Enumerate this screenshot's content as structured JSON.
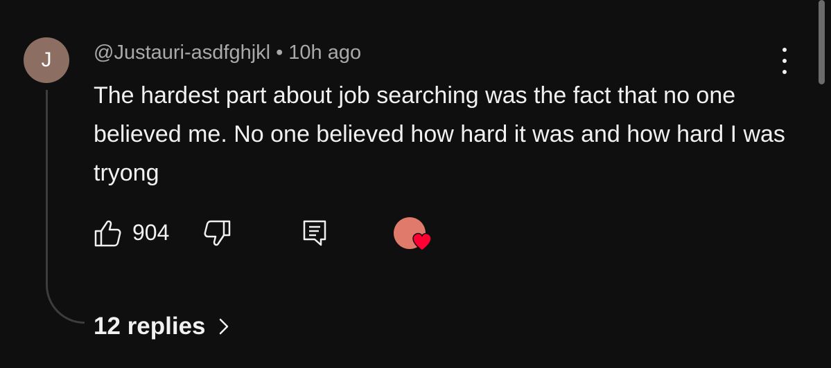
{
  "comment": {
    "avatar_letter": "J",
    "avatar_color": "#8d6e63",
    "author": "@Justauri-asdfghjkl",
    "separator": "•",
    "time": "10h ago",
    "text": "The hardest part about job searching was the fact that no one believed me. No one believed how hard it was and how hard I was tryong",
    "like_count": "904",
    "creator_heart": true,
    "heart_color": "#ff0033",
    "replies_label": "12 replies"
  },
  "icons": {
    "like": "thumbs-up-icon",
    "dislike": "thumbs-down-icon",
    "reply": "reply-icon",
    "more": "more-vert-icon",
    "chevron": "chevron-right-icon"
  },
  "colors": {
    "background": "#0f0f0f",
    "text_primary": "#f1f1f1",
    "text_secondary": "#aaaaaa"
  }
}
